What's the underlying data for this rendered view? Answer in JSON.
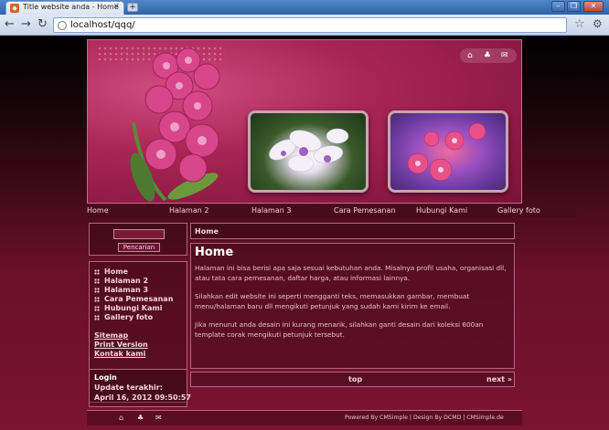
{
  "browser": {
    "tab_title": "Title website anda - Home",
    "tab_close": "×",
    "new_tab": "+",
    "url": "localhost/qqq/",
    "back": "←",
    "forward": "→",
    "reload": "↻",
    "star": "☆",
    "wrench": "🔧",
    "win_min": "–",
    "win_max": "❐",
    "win_close": "✕"
  },
  "header": {
    "icons": [
      "home-icon",
      "sitemap-icon",
      "mail-icon"
    ]
  },
  "nav": {
    "items": [
      "Home",
      "Halaman 2",
      "Halaman 3",
      "Cara Pemesanan",
      "Hubungi Kami",
      "Gallery foto"
    ]
  },
  "sidebar": {
    "search_button": "Pencarian",
    "menu": [
      "Home",
      "Halaman 2",
      "Halaman 3",
      "Cara Pemesanan",
      "Hubungi Kami",
      "Gallery foto"
    ],
    "links": [
      "Sitemap",
      "Print Version",
      "Kontak kami"
    ],
    "login": "Login",
    "update_label": "Update terakhir:",
    "update_date": "April 16, 2012 09:50:57"
  },
  "main": {
    "breadcrumb": "Home",
    "title": "Home",
    "paragraphs": [
      "Halaman ini bisa berisi apa saja sesuai kebutuhan anda. Misalnya profil usaha, organisasi dll, atau tata cara pemesanan, daftar harga, atau informasi lainnya.",
      "Silahkan edit website ini seperti mengganti teks, memasukkan gambar, membuat menu/halaman baru dll mengikuti petunjuk yang sudah kami kirim ke email.",
      "Jika menurut anda desain ini kurang menarik, silahkan ganti desain dari koleksi 600an template corak mengikuti petunjuk tersebut."
    ],
    "pager_top": "top",
    "pager_next": "next »"
  },
  "footer": {
    "text": "Powered By CMSimple | Design By DCMD | CMSimple.de"
  }
}
